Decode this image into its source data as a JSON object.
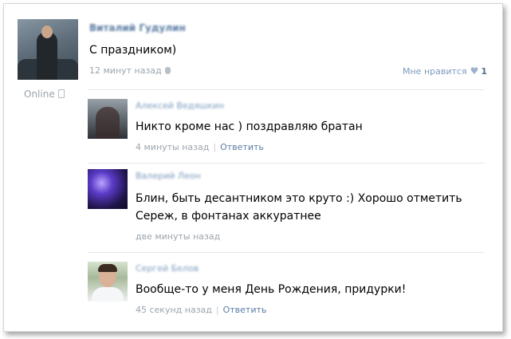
{
  "post": {
    "author": "Виталий Гудулин",
    "text": "С праздником)",
    "time": "12 минут назад",
    "online_label": "Online",
    "like_label": "Мне нравится",
    "like_count": "1"
  },
  "comments": [
    {
      "author": "Алексей Ведяшкин",
      "text": "Никто кроме нас ) поздравляю братан",
      "time": "4 минуты назад",
      "separator": "|",
      "reply_label": "Ответить"
    },
    {
      "author": "Валерий Леон",
      "text": "Блин, быть десантником это круто :) Хорошо отметить Сереж, в фонтанах аккуратнее",
      "time": "две минуты назад"
    },
    {
      "author": "Сергей Белов",
      "text": "Вообще-то у меня День Рождения, придурки!",
      "time": "45 секунд назад",
      "separator": "|",
      "reply_label": "Ответить"
    }
  ],
  "colors": {
    "link_blue": "#5b7da3",
    "meta_gray": "#9ca5ad",
    "separator": "#e4e8ec"
  }
}
